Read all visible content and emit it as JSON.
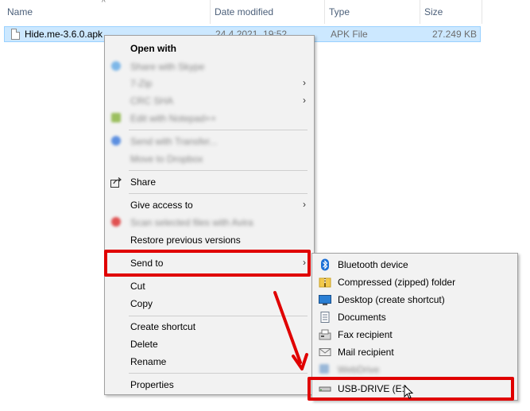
{
  "header": {
    "columns": [
      "Name",
      "Date modified",
      "Type",
      "Size"
    ],
    "sort_indicator": "^"
  },
  "file": {
    "name": "Hide.me-3.6.0.apk",
    "date": "24.4.2021. 19:52",
    "type": "APK File",
    "size": "27.249 KB"
  },
  "menu": {
    "open_with": "Open with",
    "blurred_1": "Share with Skype",
    "blurred_2": "7-Zip",
    "blurred_3": "CRC SHA",
    "blurred_4": "Edit with Notepad++",
    "blurred_5": "Send with Transfer...",
    "blurred_6": "Move to Dropbox",
    "share": "Share",
    "give_access": "Give access to",
    "blurred_7": "Scan selected files with Avira",
    "restore": "Restore previous versions",
    "send_to": "Send to",
    "cut": "Cut",
    "copy": "Copy",
    "create_shortcut": "Create shortcut",
    "delete": "Delete",
    "rename": "Rename",
    "properties": "Properties",
    "arrow": "›"
  },
  "submenu": {
    "bluetooth": "Bluetooth device",
    "compressed": "Compressed (zipped) folder",
    "desktop": "Desktop (create shortcut)",
    "documents": "Documents",
    "fax": "Fax recipient",
    "mail": "Mail recipient",
    "blurred": "WebDrive",
    "usb": "USB-DRIVE (E:)"
  },
  "colors": {
    "highlight_red": "#e00000",
    "selection_bg": "#cce8ff",
    "menu_bg": "#f2f2f2"
  }
}
